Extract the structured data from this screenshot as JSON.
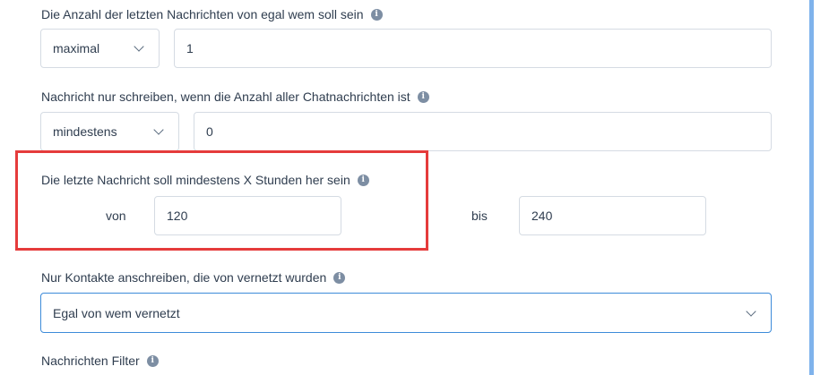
{
  "rule_max_messages": {
    "label": "Die Anzahl der letzten Nachrichten von egal wem soll sein",
    "operator": "maximal",
    "value": "1"
  },
  "rule_total_messages": {
    "label": "Nachricht nur schreiben, wenn die Anzahl aller Chatnachrichten ist",
    "operator": "mindestens",
    "value": "0"
  },
  "rule_last_message_age": {
    "label": "Die letzte Nachricht soll mindestens X Stunden her sein",
    "from_label": "von",
    "from_value": "120",
    "to_label": "bis",
    "to_value": "240"
  },
  "rule_connected_by": {
    "label": "Nur Kontakte anschreiben, die von vernetzt wurden",
    "selected": "Egal von wem vernetzt"
  },
  "message_filter": {
    "label": "Nachrichten Filter"
  },
  "icons": {
    "info": "info-icon",
    "chevron": "chevron-down-icon"
  },
  "colors": {
    "highlight": "#e53b3b",
    "focus_border": "#3d8bd9",
    "scrollbar": "#7fb3ec"
  }
}
